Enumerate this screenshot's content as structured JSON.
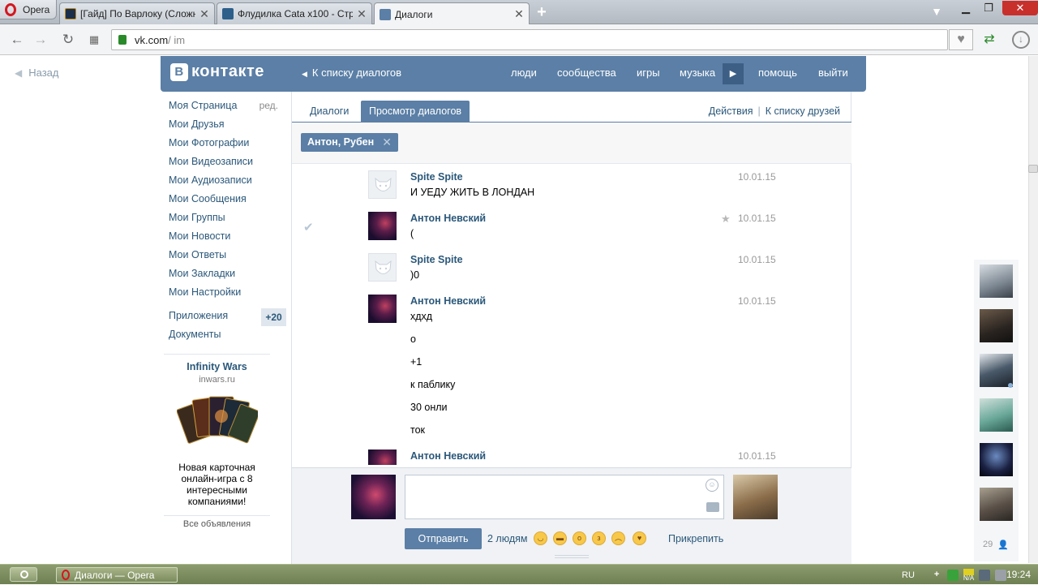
{
  "browser": {
    "menu_label": "Opera",
    "tabs": [
      {
        "title": "[Гайд] По Варлоку (Сложность: ",
        "close": "✕"
      },
      {
        "title": "Флудилка Cata x100 - Страница",
        "close": "✕"
      },
      {
        "title": "Диалоги",
        "close": "✕"
      }
    ],
    "new_tab": "+",
    "address": {
      "domain": "vk.com",
      "path": "/ im"
    }
  },
  "page": {
    "back": "Назад",
    "logo": "контакте",
    "logo_letter": "В",
    "to_dialogs": "К списку диалогов",
    "nav": [
      "люди",
      "сообщества",
      "игры",
      "музыка",
      "помощь",
      "выйти"
    ]
  },
  "leftmenu": {
    "items": [
      "Моя Страница",
      "Мои Друзья",
      "Мои Фотографии",
      "Мои Видеозаписи",
      "Мои Аудиозаписи",
      "Мои Сообщения",
      "Мои Группы",
      "Мои Новости",
      "Мои Ответы",
      "Мои Закладки",
      "Мои Настройки"
    ],
    "edit": "ред.",
    "apps": "Приложения",
    "apps_count": "+20",
    "docs": "Документы"
  },
  "ad": {
    "title": "Infinity Wars",
    "domain": "inwars.ru",
    "text": "Новая карточная онлайн-игра с 8 интересными компаниями!",
    "all": "Все объявления"
  },
  "dialog": {
    "tabs": [
      "Диалоги",
      "Просмотр диалогов"
    ],
    "actions": "Действия",
    "sep": "|",
    "to_friends": "К списку друзей",
    "tag": "Антон, Рубен",
    "tag_close": "✕",
    "messages": [
      {
        "author": "Spite Spite",
        "date": "10.01.15",
        "lines": [
          "И УЕДУ ЖИТЬ В ЛОНДАН"
        ]
      },
      {
        "author": "Антон Невский",
        "date": "10.01.15",
        "lines": [
          "("
        ]
      },
      {
        "author": "Spite Spite",
        "date": "10.01.15",
        "lines": [
          ")0"
        ]
      },
      {
        "author": "Антон Невский",
        "date": "10.01.15",
        "lines": [
          "хдхд",
          "о",
          "+1",
          "к паблику",
          "30 онли",
          "ток"
        ]
      },
      {
        "author": "Антон Невский",
        "date": "10.01.15",
        "lines": []
      }
    ]
  },
  "composer": {
    "send": "Отправить",
    "recipients": "2 людям",
    "attach": "Прикрепить"
  },
  "friends": {
    "count": "29"
  },
  "taskbar": {
    "item": "Диалоги — Opera",
    "lang": "RU",
    "na": "N/A",
    "time": "19:24"
  },
  "colors": {
    "vk_blue": "#5b7fa6",
    "link": "#2b587a",
    "taskbar": "#7b8b5c"
  }
}
